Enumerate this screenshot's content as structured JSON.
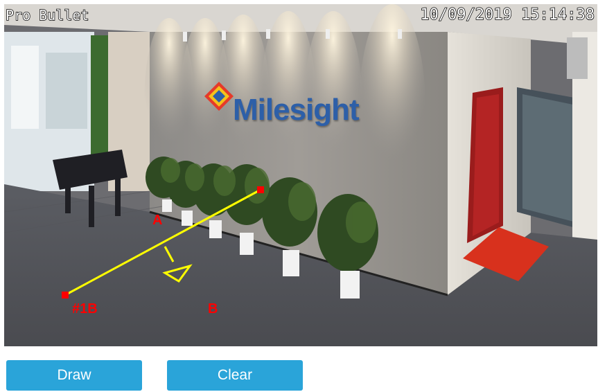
{
  "video": {
    "camera_name": "Pro Bullet",
    "timestamp": "10/09/2019 15:14:38",
    "logo_text": "Milesight",
    "overlay_color": "#ffff00",
    "handle_color": "#ff0000",
    "label_color": "#ff0000"
  },
  "line_rule": {
    "label_start": "A",
    "label_end": "B",
    "label_id": "#1B"
  },
  "toolbar": {
    "draw_label": "Draw",
    "clear_label": "Clear",
    "accent_color": "#2aa4d9"
  }
}
